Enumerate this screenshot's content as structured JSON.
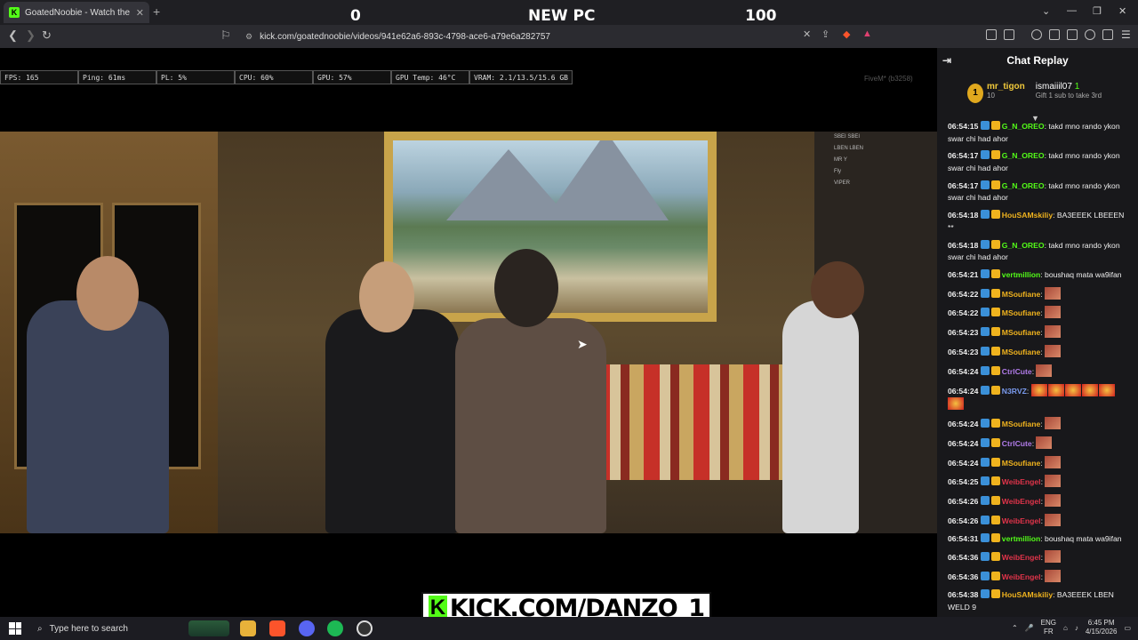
{
  "browser": {
    "tab_title": "GoatedNoobie - Watch the V",
    "tab_close": "✕",
    "new_tab": "+",
    "url": "kick.com/goatednoobie/videos/941e62a6-893c-4798-ace6-a79e6a282757"
  },
  "overlay": {
    "score_left": "0",
    "score_title": "NEW PC",
    "score_right": "100",
    "banner_k": "K",
    "banner_text": "KICK.COM/DANZO_1"
  },
  "hud": {
    "fps": "FPS: 165",
    "ping": "Ping: 61ms",
    "pl": "PL: 5%",
    "cpu": "CPU: 60%",
    "gpu": "GPU: 57%",
    "gpu_temp": "GPU Temp: 46°C",
    "vram": "VRAM: 2.1/13.5/15.6 GB",
    "fivem": "FiveM* (b3258)"
  },
  "scene_menu": [
    "SBEI SBEI",
    "LBEN LBEN",
    "MR Y",
    "Fly",
    "VIPER"
  ],
  "chat": {
    "title": "Chat Replay",
    "gifter1_name": "mr_tigon",
    "gifter1_count": "10",
    "gifter1_rank": "1",
    "gifter2_name": "ismaiiil07",
    "gifter2_count": "1",
    "gifter2_note": "Gift 1 sub to take 3rd",
    "messages": [
      {
        "time": "06:54:15",
        "user": "G_N_OREO",
        "color": "#53fc18",
        "text": ": takd mno rando ykon swar chi had ahor"
      },
      {
        "time": "06:54:17",
        "user": "G_N_OREO",
        "color": "#53fc18",
        "text": ": takd mno rando ykon swar chi had ahor"
      },
      {
        "time": "06:54:17",
        "user": "G_N_OREO",
        "color": "#53fc18",
        "text": ": takd mno rando ykon swar chi had ahor"
      },
      {
        "time": "06:54:18",
        "user": "HouSAMskiliy",
        "color": "#f0b31e",
        "text": ": BA3EEEK LBEEEN **"
      },
      {
        "time": "06:54:18",
        "user": "G_N_OREO",
        "color": "#53fc18",
        "text": ": takd mno rando ykon swar chi had ahor"
      },
      {
        "time": "06:54:21",
        "user": "vertmillion",
        "color": "#53fc18",
        "text": ": boushaq mata wa9ifan"
      },
      {
        "time": "06:54:22",
        "user": "MSoufiane",
        "color": "#f0b31e",
        "text": ":"
      },
      {
        "time": "06:54:22",
        "user": "MSoufiane",
        "color": "#f0b31e",
        "text": ":"
      },
      {
        "time": "06:54:23",
        "user": "MSoufiane",
        "color": "#f0b31e",
        "text": ":"
      },
      {
        "time": "06:54:23",
        "user": "MSoufiane",
        "color": "#f0b31e",
        "text": ":"
      },
      {
        "time": "06:54:24",
        "user": "CtrlCute",
        "color": "#b07be8",
        "text": ":"
      },
      {
        "time": "06:54:24",
        "user": "N3RVZ",
        "color": "#7b9cf0",
        "text": ":"
      },
      {
        "time": "06:54:24",
        "user": "MSoufiane",
        "color": "#f0b31e",
        "text": ":"
      },
      {
        "time": "06:54:24",
        "user": "CtrlCute",
        "color": "#b07be8",
        "text": ":"
      },
      {
        "time": "06:54:24",
        "user": "MSoufiane",
        "color": "#f0b31e",
        "text": ":"
      },
      {
        "time": "06:54:25",
        "user": "WeibEngel",
        "color": "#e0344a",
        "text": ":"
      },
      {
        "time": "06:54:26",
        "user": "WeibEngel",
        "color": "#e0344a",
        "text": ":"
      },
      {
        "time": "06:54:26",
        "user": "WeibEngel",
        "color": "#e0344a",
        "text": ":"
      },
      {
        "time": "06:54:31",
        "user": "vertmillion",
        "color": "#53fc18",
        "text": ": boushaq mata wa9ifan"
      },
      {
        "time": "06:54:36",
        "user": "WeibEngel",
        "color": "#e0344a",
        "text": ":"
      },
      {
        "time": "06:54:36",
        "user": "WeibEngel",
        "color": "#e0344a",
        "text": ":"
      },
      {
        "time": "06:54:38",
        "user": "HouSAMskiliy",
        "color": "#f0b31e",
        "text": ": BA3EEEK LBEN WELD 9"
      }
    ]
  },
  "taskbar": {
    "search_placeholder": "Type here to search",
    "lang1": "ENG",
    "lang2": "FR",
    "time": "6:45 PM",
    "date": "4/15/2026"
  }
}
